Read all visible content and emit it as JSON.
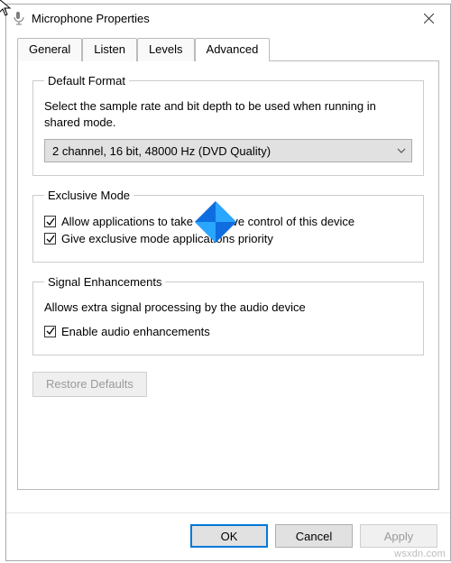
{
  "window": {
    "title": "Microphone Properties"
  },
  "tabs": {
    "items": [
      {
        "label": "General"
      },
      {
        "label": "Listen"
      },
      {
        "label": "Levels"
      },
      {
        "label": "Advanced"
      }
    ]
  },
  "default_format": {
    "legend": "Default Format",
    "description": "Select the sample rate and bit depth to be used when running in shared mode.",
    "selected": "2 channel, 16 bit, 48000 Hz (DVD Quality)"
  },
  "exclusive_mode": {
    "legend": "Exclusive Mode",
    "allow_label": "Allow applications to take exclusive control of this device",
    "priority_label": "Give exclusive mode applications priority"
  },
  "signal_enhancements": {
    "legend": "Signal Enhancements",
    "description": "Allows extra signal processing by the audio device",
    "enable_label": "Enable audio enhancements"
  },
  "buttons": {
    "restore": "Restore Defaults",
    "ok": "OK",
    "cancel": "Cancel",
    "apply": "Apply"
  },
  "watermark": "wsxdn.com"
}
